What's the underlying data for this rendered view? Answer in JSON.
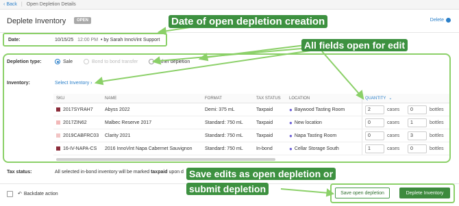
{
  "topbar": {
    "back_label": "Back",
    "crumb": "Open Depletion Details"
  },
  "header": {
    "title": "Deplete Inventory",
    "badge": "OPEN",
    "delete_label": "Delete"
  },
  "date": {
    "label": "Date:",
    "date": "10/15/25",
    "time": "12:00 PM",
    "by": "• by Sarah InnoVint Support"
  },
  "depletion_type": {
    "label": "Depletion type:",
    "options": [
      {
        "label": "Sale",
        "selected": true,
        "disabled": false
      },
      {
        "label": "Bond to bond transfer",
        "selected": false,
        "disabled": true
      },
      {
        "label": "Other depletion",
        "selected": false,
        "disabled": false
      }
    ]
  },
  "inventory": {
    "label": "Inventory:",
    "select_label": "Select Inventory"
  },
  "table": {
    "headers": {
      "sku": "SKU",
      "name": "NAME",
      "format": "FORMAT",
      "tax": "TAX STATUS",
      "location": "LOCATION",
      "quantity": "QUANTITY"
    },
    "rows": [
      {
        "sku": "2017SYRAH7",
        "color": "#8b2c3a",
        "name": "Abyss 2022",
        "format": "Demi: 375 mL",
        "tax": "Taxpaid",
        "location": "Baywood Tasting Room",
        "q1": "2",
        "u1": "cases",
        "q2": "0",
        "u2": "bottles"
      },
      {
        "sku": "2017ZIN62",
        "color": "#f2b8b8",
        "name": "Malbec Reserve 2017",
        "format": "Standard: 750 mL",
        "tax": "Taxpaid",
        "location": "New location",
        "q1": "0",
        "u1": "cases",
        "q2": "1",
        "u2": "bottles"
      },
      {
        "sku": "2019CABFRC03",
        "color": "#f2c4c4",
        "name": "Clarity 2021",
        "format": "Standard: 750 mL",
        "tax": "Taxpaid",
        "location": "Napa Tasting Room",
        "q1": "0",
        "u1": "cases",
        "q2": "3",
        "u2": "bottles"
      },
      {
        "sku": "16-IV-NAPA-CS",
        "color": "#8b2c3a",
        "name": "2016 InnoVint Napa Cabernet Sauvignon",
        "format": "Standard: 750 mL",
        "tax": "In-bond",
        "location": "Cellar Storage South",
        "q1": "1",
        "u1": "cases",
        "q2": "0",
        "u2": "bottles"
      }
    ]
  },
  "tax_status": {
    "label": "Tax status:",
    "text_pre": "All selected in-bond inventory will be marked ",
    "text_bold": "taxpaid",
    "text_post": " upon d"
  },
  "footer": {
    "backdate_label": "Backdate action",
    "save_label": "Save open depletion",
    "deplete_label": "Deplete Inventory"
  },
  "callouts": {
    "date": "Date of open depletion creation",
    "fields": "All fields open for edit",
    "save_line1": "Save edits as open depletion or",
    "save_line2": "submit depletion"
  },
  "colors": {
    "accent": "#2a7fc9",
    "green": "#3d9140",
    "highlight": "#8bd068"
  }
}
